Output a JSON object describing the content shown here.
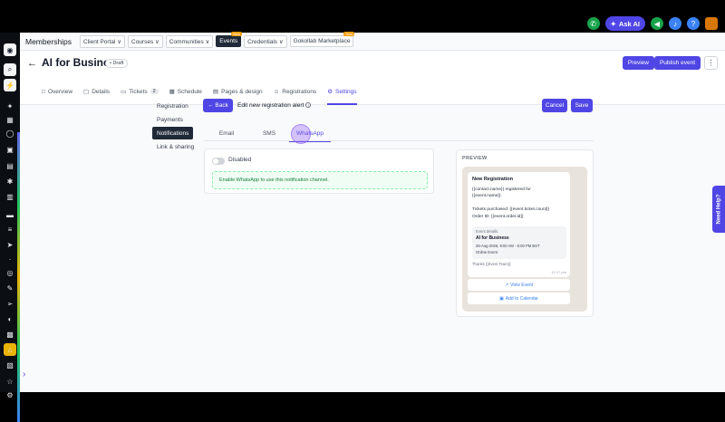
{
  "topbar": {
    "ask_ai_label": "Ask AI"
  },
  "subnav": {
    "brand": "Memberships",
    "items": [
      {
        "label": "Client Portal ∨",
        "badge": ""
      },
      {
        "label": "Courses ∨",
        "badge": ""
      },
      {
        "label": "Communities ∨",
        "badge": ""
      },
      {
        "label": "Events",
        "badge": "New"
      },
      {
        "label": "Credentials ∨",
        "badge": ""
      },
      {
        "label": "Gokollab Marketplace",
        "badge": "New"
      }
    ]
  },
  "header": {
    "title": "AI for Business",
    "status": "• Draft",
    "preview_label": "Preview",
    "publish_label": "Publish event",
    "more_label": "⋮"
  },
  "tabs": [
    {
      "label": "Overview",
      "icon": "□",
      "count": ""
    },
    {
      "label": "Details",
      "icon": "▢",
      "count": ""
    },
    {
      "label": "Tickets",
      "icon": "▭",
      "count": "2"
    },
    {
      "label": "Schedule",
      "icon": "▦",
      "count": ""
    },
    {
      "label": "Pages & design",
      "icon": "▤",
      "count": ""
    },
    {
      "label": "Registrations",
      "icon": "☺",
      "count": ""
    },
    {
      "label": "Settings",
      "icon": "⚙",
      "count": ""
    }
  ],
  "settings_menu": [
    "Registration",
    "Payments",
    "Notifications",
    "Link & sharing"
  ],
  "editor": {
    "back_label": "← Back",
    "title": "Edit new registration alert",
    "cancel_label": "Cancel",
    "save_label": "Save"
  },
  "channels": [
    "Email",
    "SMS",
    "WhatsApp"
  ],
  "toggle": {
    "label": "Disabled"
  },
  "notice": "Enable WhatsApp to use this notification channel.",
  "preview": {
    "label": "PREVIEW",
    "message_title": "New Registration",
    "line1": "{{contact.name}} registered for",
    "line2": "{{event.name}}.",
    "line3": "Tickets purchased: {{event.ticket.count}}",
    "line4": "Order ID: {{event.order.id}}",
    "event_details_label": "Event details:",
    "event_name": "AI for Business",
    "event_time": "26-Aug-2026, 9:00 AM - 5:00 PM BST",
    "event_type": "Online Event",
    "thanks": "Thanks {{Event Team}}",
    "time": "12:17 pm",
    "view_event_label": "View Event",
    "add_calendar_label": "Add to Calendar"
  },
  "need_help_label": "Need Help?"
}
